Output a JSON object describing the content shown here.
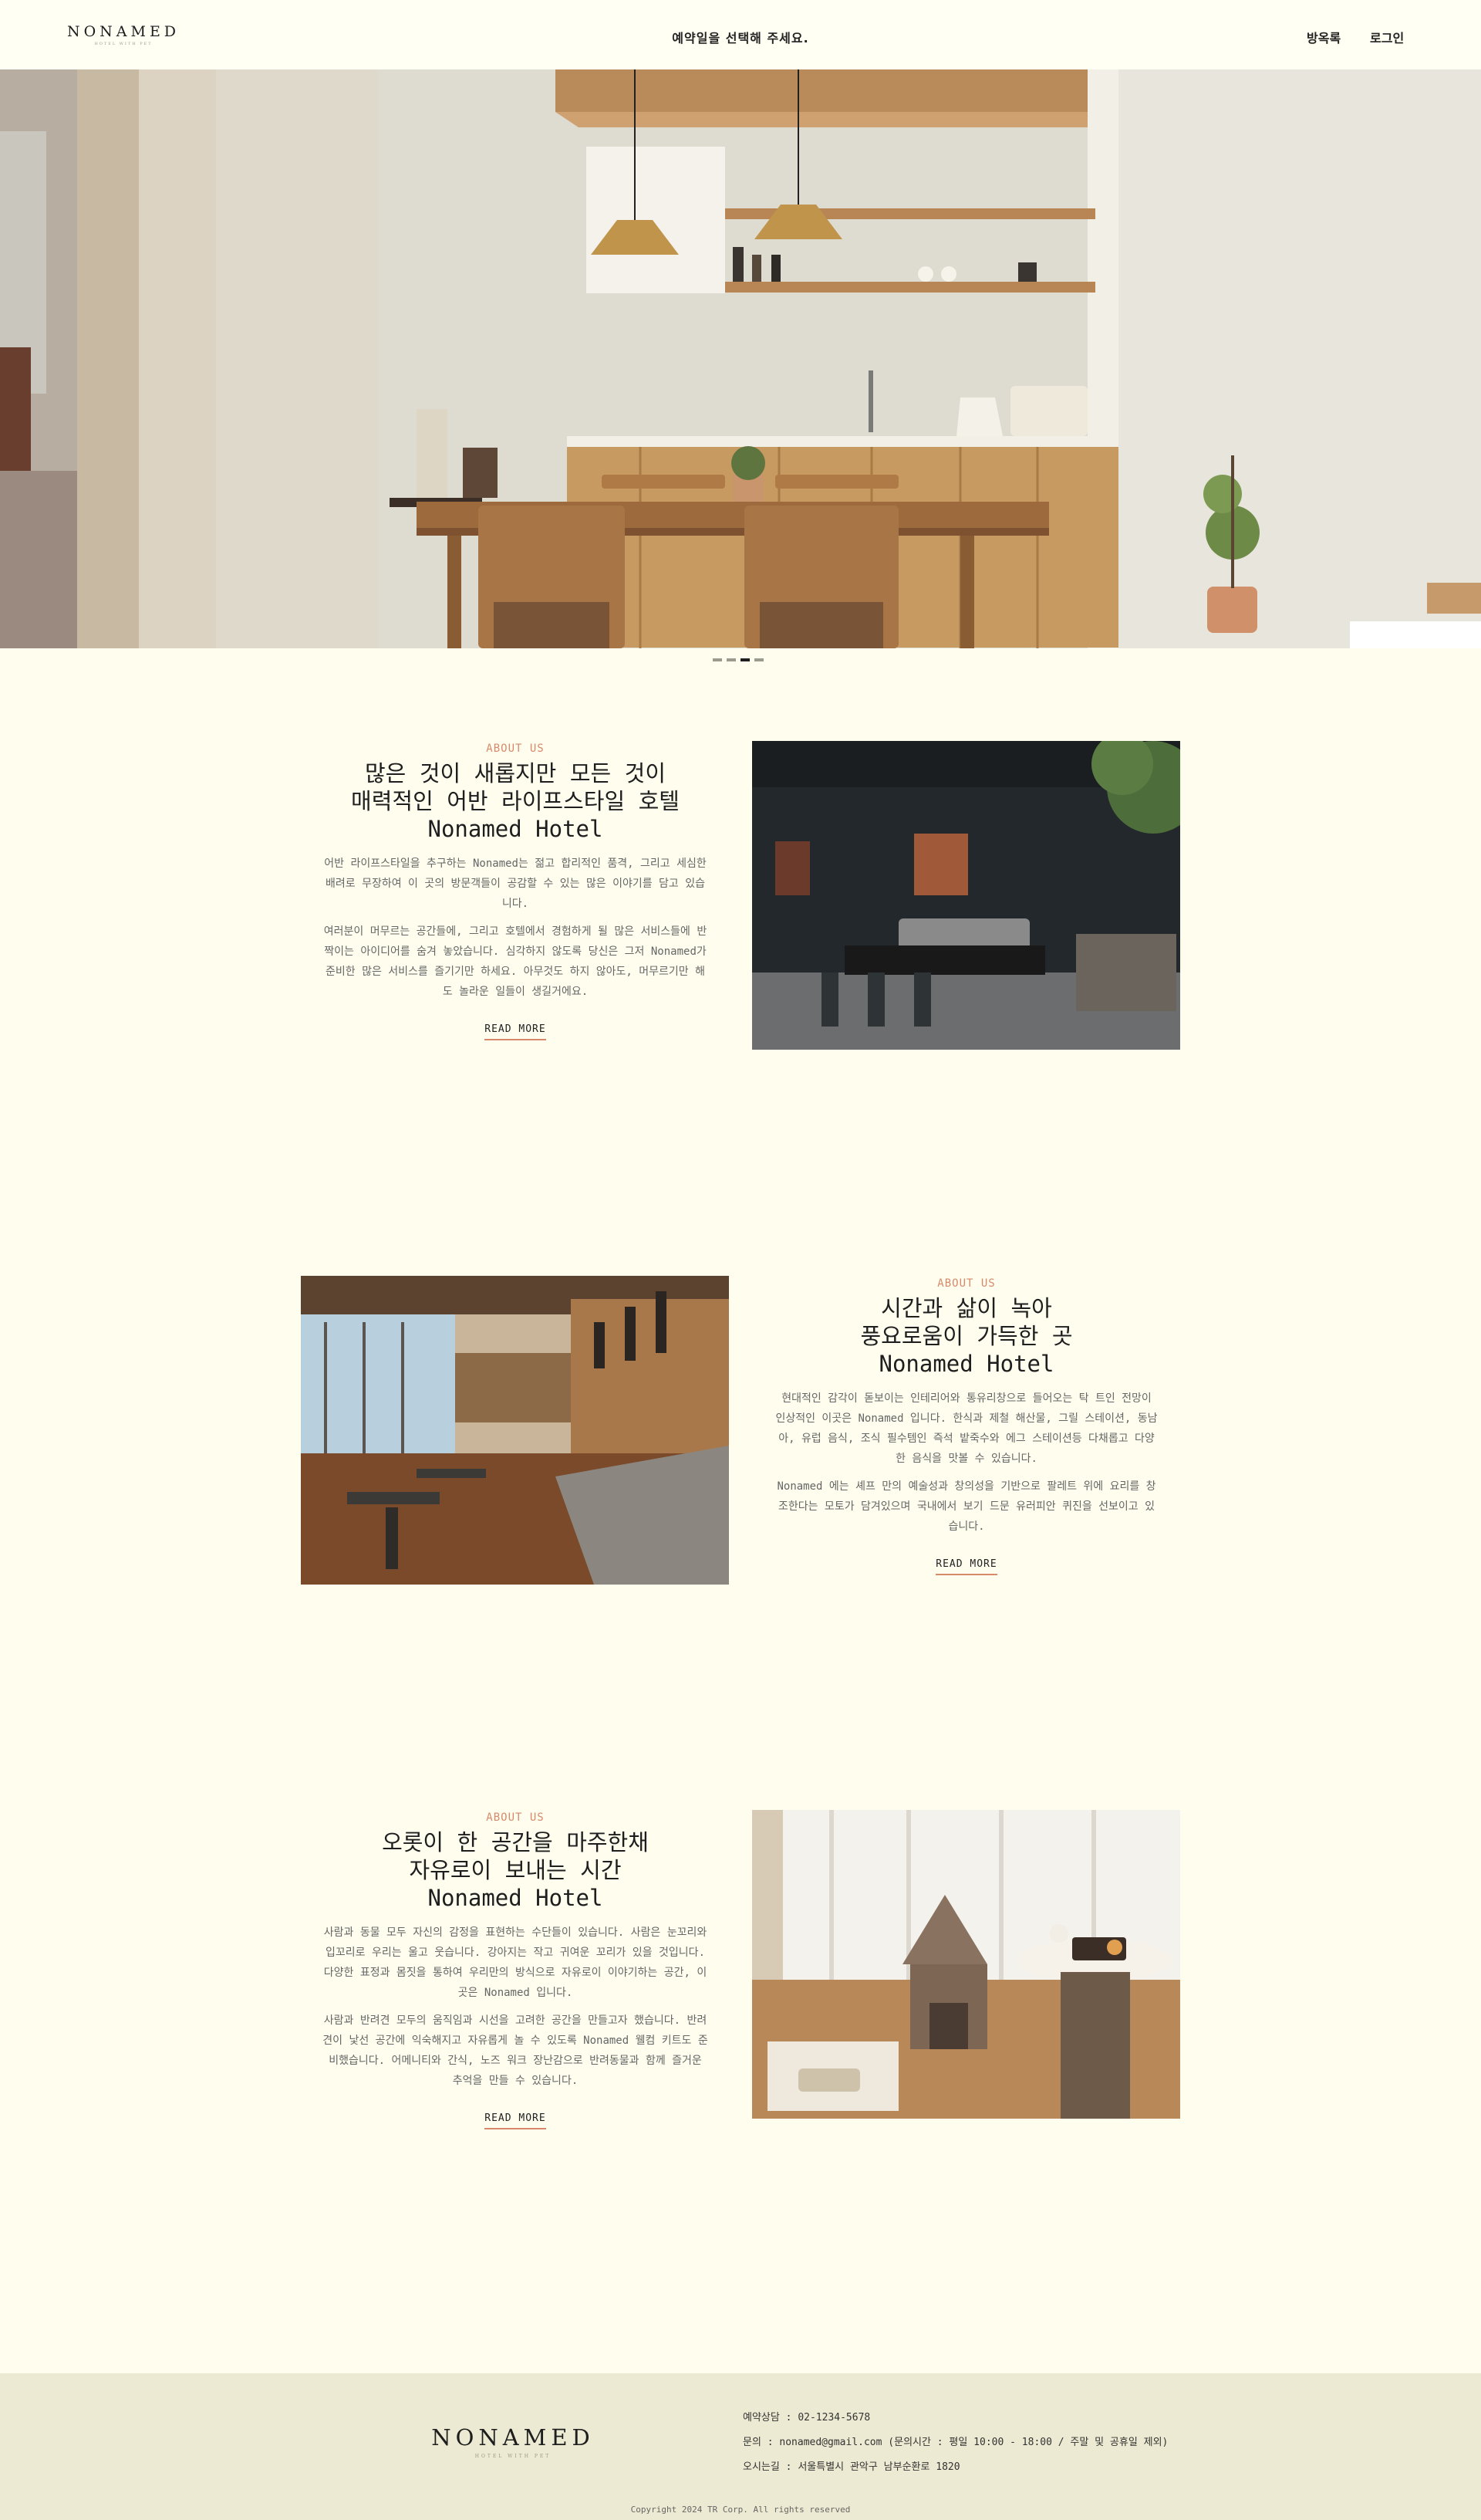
{
  "header": {
    "logo": "NONAMED",
    "logo_sub": "HOTEL WITH PET",
    "center_text": "예약일을 선택해 주세요.",
    "nav": [
      "방옥록",
      "로그인"
    ]
  },
  "hero": {
    "slides": 4,
    "active_slide": 3
  },
  "sections": [
    {
      "eyebrow": "ABOUT US",
      "title_lines": [
        "많은 것이 새롭지만 모든 것이",
        "매력적인 어반 라이프스타일 호텔",
        "Nonamed Hotel"
      ],
      "paragraphs": [
        "어반 라이프스타일을 추구하는 Nonamed는 젊고 합리적인 품격, 그리고 세심한 배려로 무장하여 이 곳의 방문객들이 공감할 수 있는 많은 이야기를 담고 있습니다.",
        "여러분이 머무르는 공간들에, 그리고 호텔에서 경험하게 될 많은 서비스들에 반짝이는 아이디어를 숨겨 놓았습니다. 심각하지 않도록 당신은 그저 Nonamed가 준비한 많은 서비스를 즐기기만 하세요. 아무것도 하지 않아도, 머무르기만 해도 놀라운 일들이 생길거에요."
      ],
      "read_more": "READ MORE"
    },
    {
      "eyebrow": "ABOUT US",
      "title_lines": [
        "시간과 삶이 녹아",
        "풍요로움이 가득한 곳",
        "Nonamed Hotel"
      ],
      "paragraphs": [
        "현대적인 감각이 돋보이는 인테리어와 통유리창으로 들어오는 탁 트인 전망이 인상적인 이곳은 Nonamed 입니다. 한식과 제철 해산물, 그릴 스테이션, 동남아, 유럽 음식, 조식 필수템인 즉석 밭죽수와 에그 스테이션등 다채롭고 다양한 음식을 맛볼 수 있습니다.",
        "Nonamed 에는 셰프 만의 예술성과 창의성을 기반으로 팔레트 위에 요리를 창조한다는 모토가 담겨있으며 국내에서 보기 드문 유러피안 퀴진을 선보이고 있습니다."
      ],
      "read_more": "READ MORE"
    },
    {
      "eyebrow": "ABOUT US",
      "title_lines": [
        "오롯이 한 공간을 마주한채",
        "자유로이 보내는 시간",
        "Nonamed Hotel"
      ],
      "paragraphs": [
        "사람과 동물 모두 자신의 감정을 표현하는 수단들이 있습니다. 사람은 눈꼬리와 입꼬리로 우리는 울고 웃습니다. 강아지는 작고 귀여운 꼬리가 있을 것입니다. 다양한 표정과 몸짓을 통하여 우리만의 방식으로 자유로이 이야기하는 공간, 이곳은 Nonamed 입니다.",
        "사람과 반려견 모두의 움직임과 시선을 고려한 공간을 만들고자 했습니다. 반려견이 낯선 공간에 익숙해지고 자유롭게 놀 수 있도록 Nonamed 웰컴 키트도 준비했습니다. 어메니티와 간식, 노즈 워크 장난감으로 반려동물과 함께 즐거운 추억을 만들 수 있습니다."
      ],
      "read_more": "READ MORE"
    }
  ],
  "footer": {
    "logo": "NONAMED",
    "logo_sub": "HOTEL WITH PET",
    "phone": "예약상담 : 02-1234-5678",
    "email": "문의 : nonamed@gmail.com (문의시간 : 평일 10:00 - 18:00 / 주말 및 공휴일 제외)",
    "address": "오시는길 : 서울특별시 관악구 남부순환로 1820",
    "copyright": "Copyright 2024 TR Corp. All rights reserved"
  }
}
